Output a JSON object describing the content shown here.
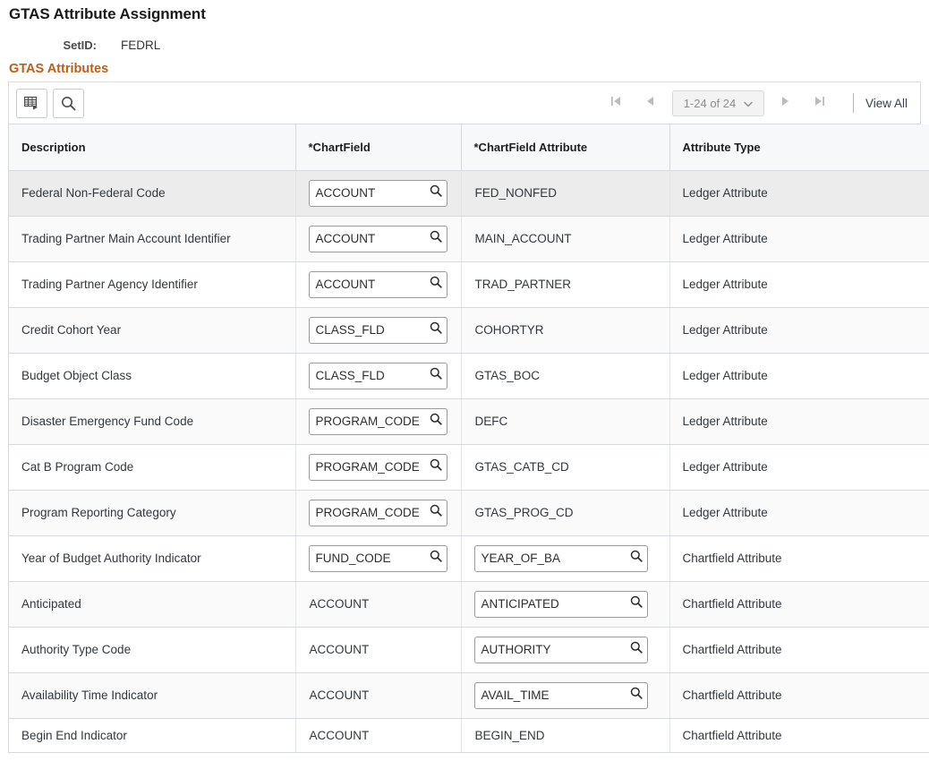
{
  "page": {
    "title": "GTAS Attribute Assignment"
  },
  "setid": {
    "label": "SetID:",
    "value": "FEDRL"
  },
  "section": {
    "title": "GTAS Attributes"
  },
  "toolbar": {
    "personalize_icon": "grid-personalize-icon",
    "find_icon": "search-icon",
    "pager": {
      "first_icon": "first-page-icon",
      "prev_icon": "previous-page-icon",
      "range": "1-24 of 24",
      "chevron_icon": "chevron-down-icon",
      "next_icon": "next-page-icon",
      "last_icon": "last-page-icon",
      "view_all": "View All"
    }
  },
  "grid": {
    "columns": [
      "Description",
      "*ChartField",
      "*ChartField Attribute",
      "Attribute Type"
    ],
    "rows": [
      {
        "description": "Federal Non-Federal Code",
        "chartfield": "ACCOUNT",
        "chartfield_editable": true,
        "attribute": "FED_NONFED",
        "attribute_editable": false,
        "type": "Ledger Attribute"
      },
      {
        "description": "Trading Partner Main Account Identifier",
        "chartfield": "ACCOUNT",
        "chartfield_editable": true,
        "attribute": "MAIN_ACCOUNT",
        "attribute_editable": false,
        "type": "Ledger Attribute"
      },
      {
        "description": "Trading Partner Agency Identifier",
        "chartfield": "ACCOUNT",
        "chartfield_editable": true,
        "attribute": "TRAD_PARTNER",
        "attribute_editable": false,
        "type": "Ledger Attribute"
      },
      {
        "description": "Credit Cohort Year",
        "chartfield": "CLASS_FLD",
        "chartfield_editable": true,
        "attribute": "COHORTYR",
        "attribute_editable": false,
        "type": "Ledger Attribute"
      },
      {
        "description": "Budget Object Class",
        "chartfield": "CLASS_FLD",
        "chartfield_editable": true,
        "attribute": "GTAS_BOC",
        "attribute_editable": false,
        "type": "Ledger Attribute"
      },
      {
        "description": "Disaster Emergency Fund Code",
        "chartfield": "PROGRAM_CODE",
        "chartfield_editable": true,
        "attribute": "DEFC",
        "attribute_editable": false,
        "type": "Ledger Attribute"
      },
      {
        "description": "Cat B Program Code",
        "chartfield": "PROGRAM_CODE",
        "chartfield_editable": true,
        "attribute": "GTAS_CATB_CD",
        "attribute_editable": false,
        "type": "Ledger Attribute"
      },
      {
        "description": "Program Reporting Category",
        "chartfield": "PROGRAM_CODE",
        "chartfield_editable": true,
        "attribute": "GTAS_PROG_CD",
        "attribute_editable": false,
        "type": "Ledger Attribute"
      },
      {
        "description": "Year of Budget Authority Indicator",
        "chartfield": "FUND_CODE",
        "chartfield_editable": true,
        "attribute": "YEAR_OF_BA",
        "attribute_editable": true,
        "type": "Chartfield Attribute"
      },
      {
        "description": "Anticipated",
        "chartfield": "ACCOUNT",
        "chartfield_editable": false,
        "attribute": "ANTICIPATED",
        "attribute_editable": true,
        "type": "Chartfield Attribute"
      },
      {
        "description": "Authority Type Code",
        "chartfield": "ACCOUNT",
        "chartfield_editable": false,
        "attribute": "AUTHORITY",
        "attribute_editable": true,
        "type": "Chartfield Attribute"
      },
      {
        "description": "Availability Time Indicator",
        "chartfield": "ACCOUNT",
        "chartfield_editable": false,
        "attribute": "AVAIL_TIME",
        "attribute_editable": true,
        "type": "Chartfield Attribute"
      },
      {
        "description": "Begin End Indicator",
        "chartfield": "ACCOUNT",
        "chartfield_editable": false,
        "attribute": "BEGIN_END",
        "attribute_editable": false,
        "type": "Chartfield Attribute"
      }
    ]
  },
  "colors": {
    "section_heading": "#bc5f16",
    "header_bg": "#f7f8f9",
    "first_row_bg": "#ececec",
    "alt_row_bg": "#fafafa",
    "grid_border": "#d6dade"
  }
}
